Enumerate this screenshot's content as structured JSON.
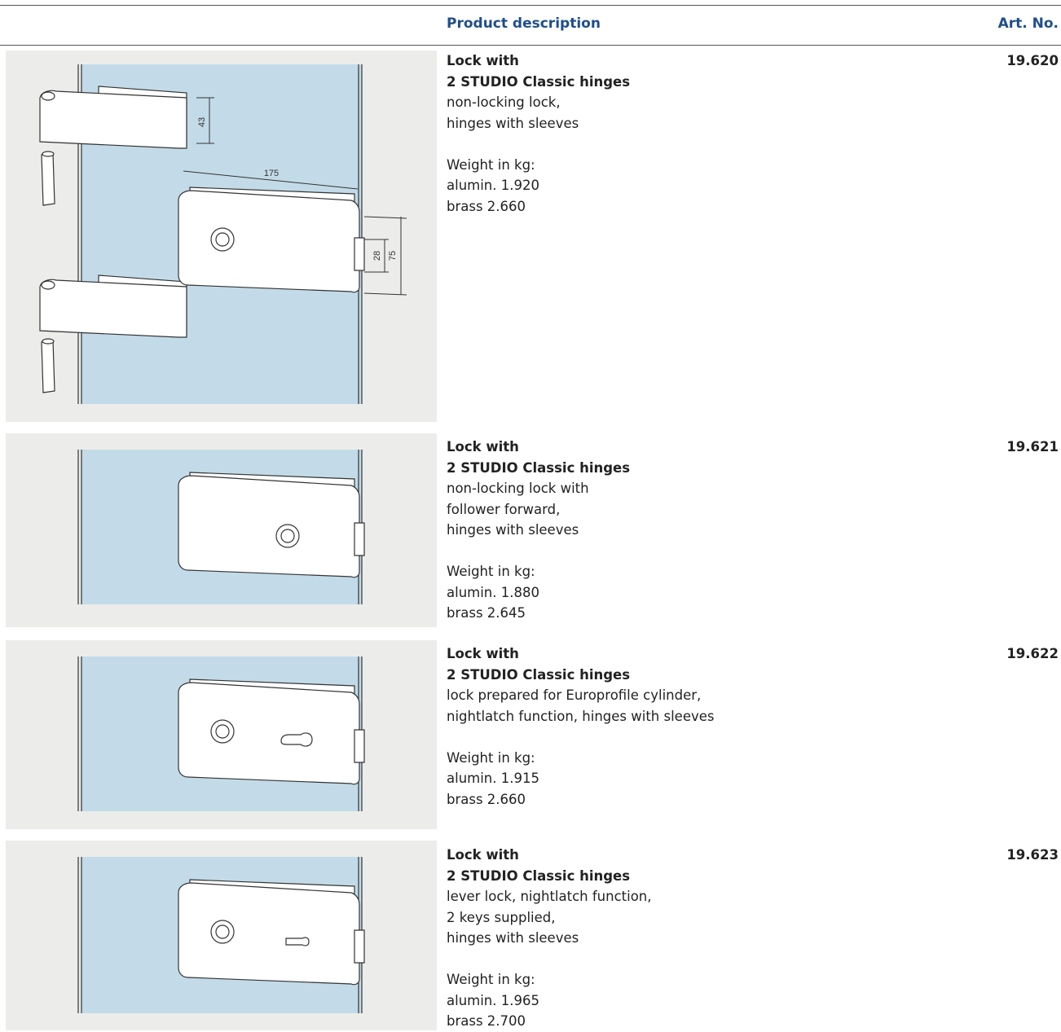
{
  "header": {
    "description_label": "Product description",
    "art_no_label": "Art. No."
  },
  "products": [
    {
      "title": [
        "Lock with",
        "2 STUDIO Classic hinges"
      ],
      "lines": [
        "non-locking lock,",
        "hinges with sleeves"
      ],
      "weight_label": "Weight in kg:",
      "weights": [
        "alumin. 1.920",
        "brass 2.660"
      ],
      "art_no": "19.620",
      "drawing": {
        "variant": "lock-with-hinges-dimensioned",
        "dimensions": [
          "43",
          "175",
          "28",
          "75"
        ]
      }
    },
    {
      "title": [
        "Lock with",
        "2 STUDIO Classic hinges"
      ],
      "lines": [
        "non-locking lock with",
        "follower forward,",
        "hinges with sleeves"
      ],
      "weight_label": "Weight in kg:",
      "weights": [
        "alumin. 1.880",
        "brass 2.645"
      ],
      "art_no": "19.621",
      "drawing": {
        "variant": "follower-forward"
      }
    },
    {
      "title": [
        "Lock with",
        "2 STUDIO Classic hinges"
      ],
      "lines": [
        "lock prepared for Europrofile cylinder,",
        "nightlatch function, hinges with sleeves"
      ],
      "weight_label": "Weight in kg:",
      "weights": [
        "alumin. 1.915",
        "brass 2.660"
      ],
      "art_no": "19.622",
      "drawing": {
        "variant": "europrofile-cylinder"
      }
    },
    {
      "title": [
        "Lock with",
        "2 STUDIO Classic hinges"
      ],
      "lines": [
        "lever lock, nightlatch function,",
        "2 keys supplied,",
        "hinges with sleeves"
      ],
      "weight_label": "Weight in kg:",
      "weights": [
        "alumin. 1.965",
        "brass 2.700"
      ],
      "art_no": "19.623",
      "drawing": {
        "variant": "lever-lock"
      }
    }
  ],
  "colors": {
    "heading_blue": "#1f4e8c",
    "panel_bg": "#ececea",
    "glass_blue": "#c3dbe8",
    "line": "#333333"
  }
}
